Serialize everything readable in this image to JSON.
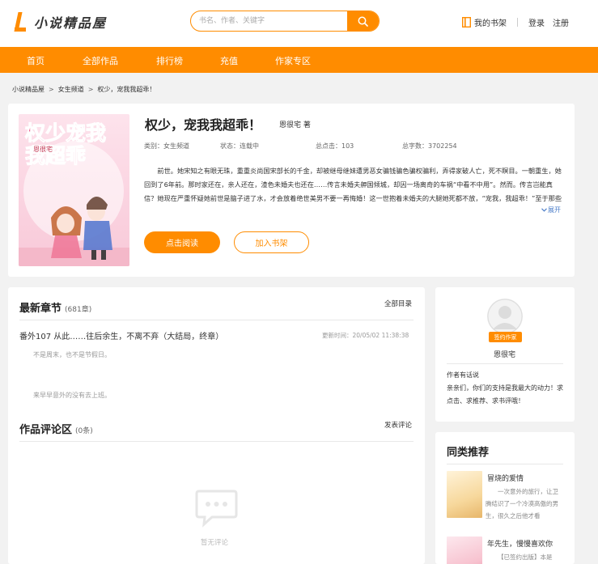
{
  "header": {
    "logo_text": "小说精品屋",
    "search_placeholder": "书名、作者、关键字",
    "bookshelf_label": "我的书架",
    "login_label": "登录",
    "register_label": "注册"
  },
  "nav": {
    "items": [
      "首页",
      "全部作品",
      "排行榜",
      "充值",
      "作家专区"
    ]
  },
  "breadcrumb": {
    "items": [
      "小说精品屋",
      "女生频道",
      "权少，宠我我超乖！"
    ]
  },
  "book": {
    "title": "权少，宠我我超乖！",
    "author": "恩很宅 著",
    "category": "类别：女生频道",
    "status": "状态：连载中",
    "clicks": "总点击：103",
    "word_count": "总字数：3702254",
    "intro": "前世。她宋知之有眼无珠，重重炎尚国宋部长的千金，却被继母继妹遭男恶女骗钱骗色骗权骗利，弄得家破人亡，死不瞑目。一朝重生，她回到了6年前。那时家还在，亲人还在，渣色未婚夫也还在……传言未婚夫舺国倾城，却因一场离奇的车祸“中看不中用”。然而。传言岂能真信？她现在严重怀疑她前世是脑子进了水，才会放着绝世美男不要一再悔婚！这一世抱着未婚夫的大腿她死都不放，“宠我，我超乖！”至于那些害她之人，不弄他个身败名裂、不得好死她誓不罢休！",
    "expand_label": "展开",
    "read_button": "点击阅读",
    "shelf_button": "加入书架",
    "cover_title_text": "权少宠我我超乖",
    "cover_author_text": "恩很宅"
  },
  "latest": {
    "title": "最新章节",
    "count": "(681章)",
    "all_link": "全部目录",
    "chapter_title": "番外107 从此……往后余生，不离不弃（大结局，终章）",
    "update_time": "更新时间：20/05/02 11:38:38",
    "snippets": [
      "不是周末，也不是节假日。",
      "来早早意外的没有去上班。"
    ]
  },
  "comments": {
    "title": "作品评论区",
    "count": "(0条)",
    "post_link": "发表评论",
    "empty_text": "暂无评论"
  },
  "author_panel": {
    "badge": "签约作家",
    "name": "恩很宅",
    "say_label": "作者有话说",
    "say_text": "亲亲们，你们的支持是我最大的动力！求点击、求推荐、求书评哦！"
  },
  "recommend": {
    "title": "同类推荐",
    "items": [
      {
        "title": "冒烧的爱情",
        "desc": "一次意外的旅行，让卫腾结识了一个冷漠高傲的男生，很久之后他才看"
      },
      {
        "title": "年先生，慢慢喜欢你",
        "desc": "【已签约出版】本是"
      }
    ]
  },
  "colors": {
    "accent": "#ff8c00",
    "link_blue": "#4a7cc8",
    "background": "#f2f2f2"
  }
}
